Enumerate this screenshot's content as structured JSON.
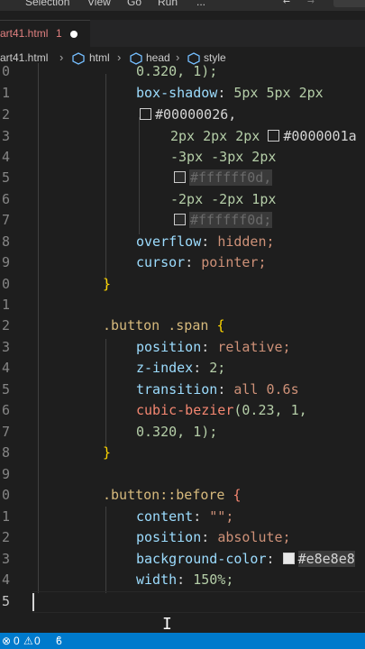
{
  "menu": {
    "items": [
      "Selection",
      "View",
      "Go",
      "Run",
      "..."
    ]
  },
  "tab": {
    "label": "art41.html",
    "count": "1"
  },
  "breadcrumb": {
    "file": "art41.html",
    "items": [
      "html",
      "head",
      "style"
    ]
  },
  "line_numbers": [
    "0",
    "1",
    "2",
    "3",
    "4",
    "5",
    "6",
    "7",
    "8",
    "9",
    "0",
    "1",
    "2",
    "3",
    "4",
    "5",
    "6",
    "7",
    "8",
    "9",
    "0",
    "1",
    "2",
    "3",
    "4",
    "5"
  ],
  "code": {
    "l0": "0.320, 1);",
    "box_shadow_prop": "box-shadow",
    "box_shadow_val1": "5px 5px 2px",
    "color1": "#00000026,",
    "shadow2": "2px 2px 2px",
    "color2": "#0000001a",
    "shadow3": "-3px -3px 2px",
    "color3": "#ffffff0d,",
    "shadow4": "-2px -2px 1px",
    "color4": "#ffffff0d;",
    "overflow_prop": "overflow",
    "overflow_val": "hidden;",
    "cursor_prop": "cursor",
    "cursor_val": "pointer;",
    "close1": "}",
    "selector1": ".button .span",
    "open1": "{",
    "position_prop": "position",
    "position_val": "relative;",
    "zindex_prop": "z-index",
    "zindex_val": "2;",
    "transition_prop": "transition",
    "transition_val": "all 0.6s",
    "cubic": "cubic-bezier",
    "cubic_args": "(0.23, 1,",
    "cubic_args2": "0.320, 1);",
    "close2": "}",
    "selector2": ".button::before",
    "open2": "{",
    "content_prop": "content",
    "content_val": "\"\";",
    "position2_prop": "position",
    "position2_val": "absolute;",
    "bg_prop": "background-color",
    "bg_val": "#e8e8e8",
    "width_prop": "width",
    "width_val": "150%;"
  },
  "status": {
    "errors": "0",
    "warnings": "0"
  }
}
